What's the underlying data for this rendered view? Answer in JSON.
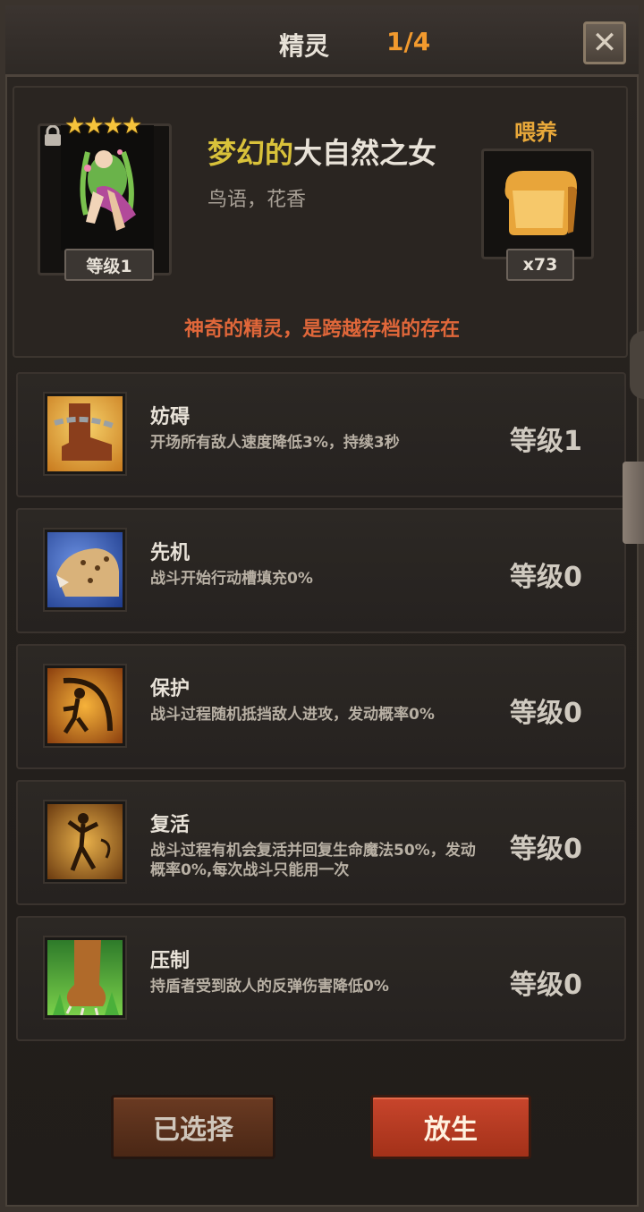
{
  "title": "精灵",
  "page_count": "1/4",
  "close_label": "✕",
  "spirit": {
    "name_adj": "梦幻的",
    "name_noun": "大自然之女",
    "subtitle": "鸟语，花香",
    "stars": "★★★★",
    "level": "等级1"
  },
  "feed": {
    "label": "喂养",
    "count": "x73"
  },
  "tagline": "神奇的精灵，是跨越存档的存在",
  "skills": [
    {
      "name": "妨碍",
      "desc": "开场所有敌人速度降低3%，持续3秒",
      "level": "等级1"
    },
    {
      "name": "先机",
      "desc": "战斗开始行动槽填充0%",
      "level": "等级0"
    },
    {
      "name": "保护",
      "desc": "战斗过程随机抵挡敌人进攻，发动概率0%",
      "level": "等级0"
    },
    {
      "name": "复活",
      "desc": "战斗过程有机会复活并回复生命魔法50%，发动概率0%,每次战斗只能用一次",
      "level": "等级0"
    },
    {
      "name": "压制",
      "desc": "持盾者受到敌人的反弹伤害降低0%",
      "level": "等级0"
    }
  ],
  "buttons": {
    "selected": "已选择",
    "release": "放生"
  },
  "icons": {
    "lock": "lock-icon",
    "close": "close-icon",
    "feed_item": "bread-icon",
    "skill_icons": [
      "chained-boot-icon",
      "leopard-icon",
      "shield-spirit-icon",
      "revive-spirit-icon",
      "beast-claw-icon"
    ]
  }
}
